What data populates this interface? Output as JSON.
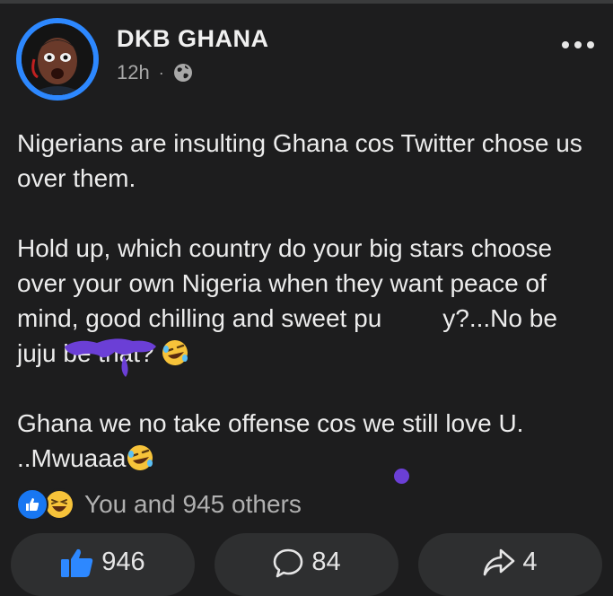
{
  "post": {
    "author": "DKB GHANA",
    "time": "12h",
    "separator": "·",
    "privacy_icon": "globe-icon",
    "paragraph_1": "Nigerians are insulting Ghana cos Twitter chose us over them.",
    "paragraph_2_main": "Hold up, which country do your big stars choose over your own Nigeria when they want peace of mind, good chilling and sweet pu",
    "paragraph_2_tail": "y?...No be juju be that?",
    "paragraph_3_line1": "Ghana we no take offense cos we still love U.",
    "paragraph_3_line2": "..Mwuaaa"
  },
  "reactions": {
    "icons": [
      "like-icon",
      "haha-icon"
    ],
    "summary": "You and 945 others"
  },
  "actions": {
    "like_count": "946",
    "comment_count": "84",
    "share_count": "4"
  },
  "colors": {
    "background": "#1d1d1e",
    "accent": "#1877f2",
    "button_bg": "#2e2f30",
    "scribble": "#6b3fd6"
  }
}
